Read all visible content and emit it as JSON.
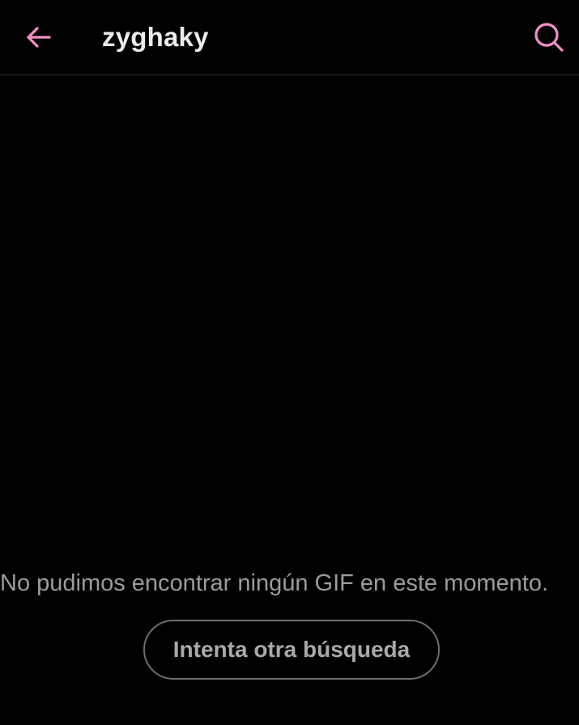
{
  "header": {
    "search_query": "zyghaky",
    "back_icon": "arrow-left-icon",
    "search_icon": "search-icon",
    "accent_color": "#f48fc8"
  },
  "empty_state": {
    "message": "No pudimos encontrar ningún GIF en este momento.",
    "retry_label": "Intenta otra búsqueda"
  }
}
